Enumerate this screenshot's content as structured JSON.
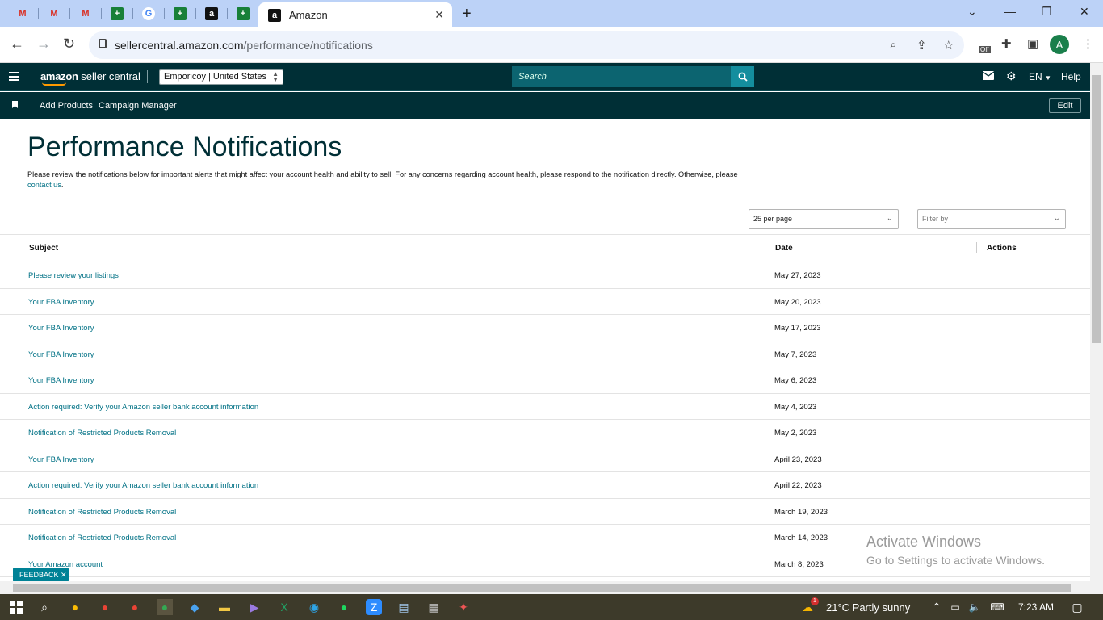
{
  "browser": {
    "active_tab_title": "Amazon",
    "pinned_tabs": [
      "gmail-icon",
      "gmail-icon",
      "gmail-icon",
      "sheets-icon",
      "google-icon",
      "sheets-icon",
      "amazon-icon",
      "sheets-icon"
    ],
    "url_domain": "sellercentral.amazon.com",
    "url_path": "/performance/notifications",
    "profile_initial": "A",
    "extension_badge": "Off"
  },
  "header": {
    "logo_brand": "amazon",
    "logo_suffix": " seller central",
    "store_selector": "Emporicoy | United States",
    "search_placeholder": "Search",
    "language": "EN",
    "help": "Help"
  },
  "subnav": {
    "links": [
      "Add Products",
      "Campaign Manager"
    ],
    "edit": "Edit"
  },
  "page": {
    "title": "Performance Notifications",
    "intro_text": "Please review the notifications below for important alerts that might affect your account health and ability to sell. For any concerns regarding account health, please respond to the notification directly. Otherwise, please ",
    "intro_link": "contact us",
    "intro_end": ".",
    "per_page": "25 per page",
    "filter_placeholder": "Filter by"
  },
  "table": {
    "columns": [
      "Subject",
      "Date",
      "Actions"
    ],
    "rows": [
      {
        "subject": "Please review your listings",
        "date": "May 27, 2023"
      },
      {
        "subject": "Your FBA Inventory",
        "date": "May 20, 2023"
      },
      {
        "subject": "Your FBA Inventory",
        "date": "May 17, 2023"
      },
      {
        "subject": "Your FBA Inventory",
        "date": "May 7, 2023"
      },
      {
        "subject": "Your FBA Inventory",
        "date": "May 6, 2023"
      },
      {
        "subject": "Action required: Verify your Amazon seller bank account information",
        "date": "May 4, 2023"
      },
      {
        "subject": "Notification of Restricted Products Removal",
        "date": "May 2, 2023"
      },
      {
        "subject": "Your FBA Inventory",
        "date": "April 23, 2023"
      },
      {
        "subject": "Action required: Verify your Amazon seller bank account information",
        "date": "April 22, 2023"
      },
      {
        "subject": "Notification of Restricted Products Removal",
        "date": "March 19, 2023"
      },
      {
        "subject": "Notification of Restricted Products Removal",
        "date": "March 14, 2023"
      },
      {
        "subject": "Your Amazon account",
        "date": "March 8, 2023"
      }
    ]
  },
  "feedback": "FEEDBACK",
  "watermark": {
    "line1": "Activate Windows",
    "line2": "Go to Settings to activate Windows."
  },
  "taskbar": {
    "weather_badge": "1",
    "weather": "21°C  Partly sunny",
    "time": "7:23 AM"
  },
  "colors": {
    "header_bg": "#002f36",
    "link": "#007185",
    "search_btn": "#148e9e",
    "feedback_bg": "#008296"
  }
}
